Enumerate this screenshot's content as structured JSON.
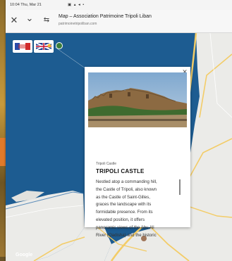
{
  "statusbar": {
    "time": "10:04 Thu, Mar 21",
    "icons": "▣ ▴ ◂ •"
  },
  "titlebar": {
    "close_icon": "✕",
    "chevron_icon": "⌄",
    "settings_icon": "⇆",
    "title": "Map – Association Patrimoine Tripoli Liban",
    "url": "patrimoinetripoliban.com"
  },
  "map": {
    "language_flags": [
      "fr",
      "en"
    ],
    "provider": "Google",
    "colors": {
      "sea": "#1d5c91",
      "land": "#ebebe8",
      "road": "#f3cc67"
    }
  },
  "popup": {
    "close_label": "✕",
    "category": "Tripoli Castle",
    "title": "TRIPOLI CASTLE",
    "body_lines": [
      "Nestled atop a commanding hill,",
      "the Castle of Tripoli, also known",
      "as the Castle of Saint-Gilles,",
      "graces the landscape with its",
      "formidable presence. From its",
      "elevated position, it offers",
      "panoramic views of the Abu Ali",
      "River (Qadisha) and the historic"
    ]
  }
}
